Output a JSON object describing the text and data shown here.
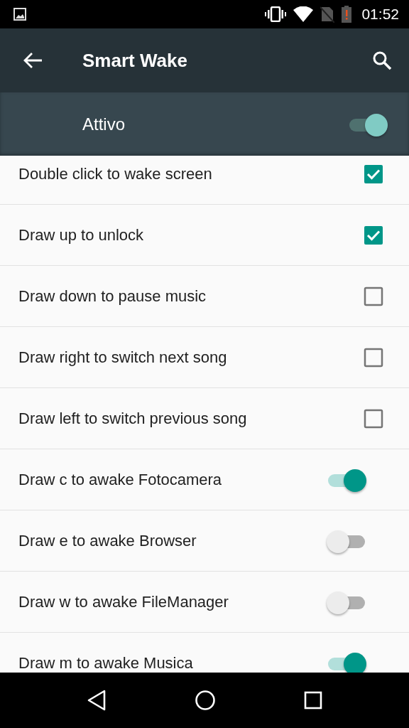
{
  "status_bar": {
    "time": "01:52"
  },
  "toolbar": {
    "title": "Smart Wake"
  },
  "master_switch": {
    "label": "Attivo",
    "on": true
  },
  "items": [
    {
      "kind": "checkbox",
      "label": "Double click to wake screen",
      "checked": true
    },
    {
      "kind": "checkbox",
      "label": "Draw up to unlock",
      "checked": true
    },
    {
      "kind": "checkbox",
      "label": "Draw down to pause music",
      "checked": false
    },
    {
      "kind": "checkbox",
      "label": "Draw right to switch next song",
      "checked": false
    },
    {
      "kind": "checkbox",
      "label": "Draw left to switch previous song",
      "checked": false
    },
    {
      "kind": "switch",
      "label": "Draw c to awake Fotocamera",
      "on": true
    },
    {
      "kind": "switch",
      "label": "Draw e to awake Browser",
      "on": false
    },
    {
      "kind": "switch",
      "label": "Draw w to awake FileManager",
      "on": false
    },
    {
      "kind": "switch",
      "label": "Draw m to awake Musica",
      "on": true
    }
  ]
}
